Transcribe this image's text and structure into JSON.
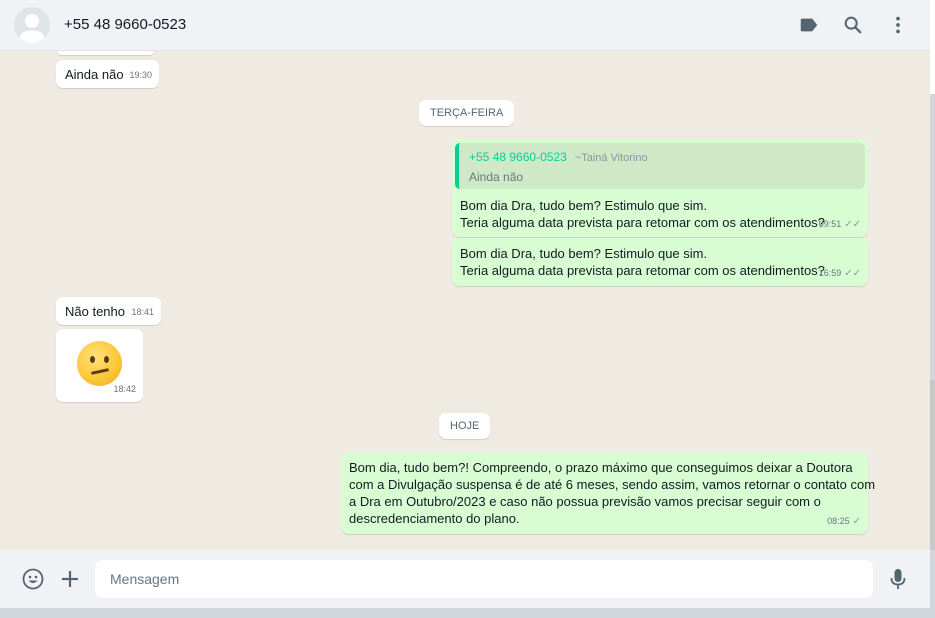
{
  "header": {
    "contact_name": "+55 48 9660-0523",
    "icons": [
      "label-icon",
      "search-icon",
      "menu-icon"
    ]
  },
  "messages": {
    "m1": {
      "text": "Ainda não",
      "time": "19:30"
    },
    "day1": "TERÇA-FEIRA",
    "m2": {
      "quote_name": "+55 48 9660-0523",
      "quote_author": "~Tainá Vitorino",
      "quote_text": "Ainda não",
      "line1": "Bom dia Dra, tudo bem? Estimulo que sim.",
      "line2": "Teria alguma data prevista para retomar com os atendimentos?",
      "time": "09:51"
    },
    "m3": {
      "line1": "Bom dia Dra, tudo bem? Estimulo que sim.",
      "line2": "Teria alguma data prevista para retomar com os atendimentos?",
      "time": "16:59"
    },
    "m4": {
      "text": "Não tenho",
      "time": "18:41"
    },
    "m5": {
      "emoji": "confused-face",
      "time": "18:42"
    },
    "day2": "HOJE",
    "m6": {
      "line1": "Bom dia, tudo bem?! Compreendo, o prazo máximo que conseguimos deixar a Doutora",
      "line2": "com a Divulgação suspensa é de até 6 meses, sendo assim, vamos retornar o contato com",
      "line3": "a Dra em Outubro/2023 e caso não possua previsão vamos precisar seguir com o",
      "line4": "descredenciamento do plano.",
      "time": "08:25"
    }
  },
  "composer": {
    "placeholder": "Mensagem"
  },
  "colors": {
    "outgoing": "#d9fdd3",
    "incoming": "#ffffff",
    "accent": "#06cf9c",
    "background": "#efeae2"
  }
}
